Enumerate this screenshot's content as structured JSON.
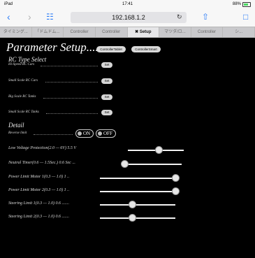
{
  "status": {
    "device": "iPad",
    "time": "17:41",
    "battery": "88%"
  },
  "nav": {
    "url": "192.168.1.2"
  },
  "tabs": [
    {
      "label": "タイミング..."
    },
    {
      "label": "「ドムドム..."
    },
    {
      "label": "Controller"
    },
    {
      "label": "Controller"
    },
    {
      "label": "Setup"
    },
    {
      "label": "マツダ/ロ..."
    },
    {
      "label": "Controller"
    },
    {
      "label": "シ..."
    }
  ],
  "page": {
    "title": "Parameter Setup....",
    "header_buttons": [
      "ControllerTablet",
      "ControllerSmart"
    ],
    "rc_type_heading": "RC Type Select",
    "rc_types": [
      {
        "label": "Hi-Speed RC Cars",
        "button": "Set"
      },
      {
        "label": "Small Scale RC Cars",
        "button": "Set"
      },
      {
        "label": "Big Scale RC Tanks",
        "button": "Set"
      },
      {
        "label": "Small Scale RC Tanks",
        "button": "Set"
      }
    ],
    "detail_heading": "Detail",
    "reverse_label": "Reverse limit",
    "reverse_on": "ON",
    "reverse_off": "OFF",
    "sliders": [
      {
        "label": "Low Voltage Protection(2.0 — 6V) 5.5 V",
        "value": 0.55
      },
      {
        "label": "Neutral Timer(0.6 — 1.5Sec.) 0.6 Sec ...",
        "value": 0.0
      },
      {
        "label": "Power Limit Motor 1(0.3 — 1.0) 1 ..",
        "value": 1.0
      },
      {
        "label": "Power Limit Motor 2(0.3 — 1.0) 1 ..",
        "value": 1.0
      },
      {
        "label": "Steering Limit 1(0.3 — 1.0) 0.6 .......",
        "value": 0.43
      },
      {
        "label": "Steering Limit 2(0.3 — 1.0) 0.6 .......",
        "value": 0.43
      }
    ]
  }
}
